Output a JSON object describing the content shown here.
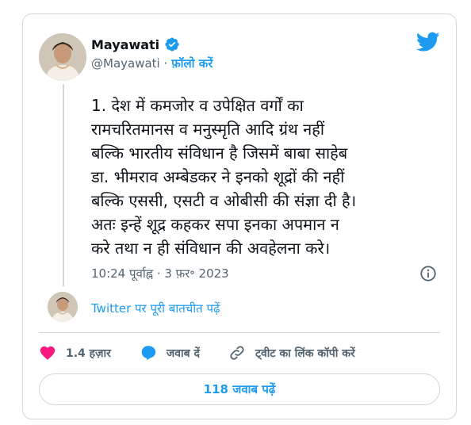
{
  "author": {
    "name": "Mayawati",
    "handle": "@Mayawati",
    "separator": "·",
    "follow_label": "फ़ॉलो करें"
  },
  "tweet": {
    "text": "1. देश में कमजोर व उपेक्षित वर्गों का\nरामचरितमानस व मनुस्मृति आदि ग्रंथ नहीं\nबल्कि भारतीय संविधान है जिसमें बाबा साहेब\nडा. भीमराव अम्बेडकर ने इनको शूद्रों की नहीं\nबल्कि एससी, एसटी व ओबीसी की संज्ञा दी है।\nअतः इन्हें शूद्र कहकर सपा इनका अपमान न\nकरे तथा न ही संविधान की अवहेलना करे।",
    "timestamp": "10:24 पूर्वाह्न · 3 फ़र॰ 2023"
  },
  "conversation_link": "Twitter पर पूरी बातचीत पढ़ें",
  "actions": {
    "likes": "1.4 हज़ार",
    "reply": "जवाब दें",
    "copy_link": "ट्वीट का लिंक कॉपी करें"
  },
  "read_replies_label": "118 जवाब पढ़ें",
  "colors": {
    "accent": "#1d9bf0",
    "like": "#f91880",
    "muted": "#536471",
    "border": "#cfd9de"
  },
  "icons": {
    "brand": "twitter-bird-icon",
    "verified": "verified-badge-icon",
    "info": "info-icon",
    "like": "heart-icon",
    "reply": "reply-bubble-icon",
    "copy": "link-icon"
  }
}
